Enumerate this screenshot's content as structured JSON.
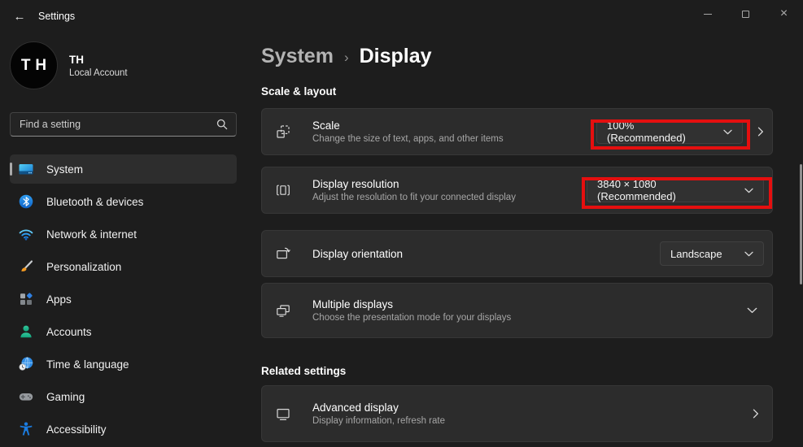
{
  "titlebar": {
    "title": "Settings",
    "back_glyph": "←",
    "close_glyph": "×"
  },
  "profile": {
    "initials": "TH",
    "name": "TH",
    "account_type": "Local Account"
  },
  "search": {
    "placeholder": "Find a setting",
    "icon": "search-icon"
  },
  "sidebar": {
    "items": [
      {
        "label": "System",
        "icon": "system-icon",
        "selected": true
      },
      {
        "label": "Bluetooth & devices",
        "icon": "bluetooth-icon",
        "selected": false
      },
      {
        "label": "Network & internet",
        "icon": "network-icon",
        "selected": false
      },
      {
        "label": "Personalization",
        "icon": "personalization-icon",
        "selected": false
      },
      {
        "label": "Apps",
        "icon": "apps-icon",
        "selected": false
      },
      {
        "label": "Accounts",
        "icon": "accounts-icon",
        "selected": false
      },
      {
        "label": "Time & language",
        "icon": "time-language-icon",
        "selected": false
      },
      {
        "label": "Gaming",
        "icon": "gaming-icon",
        "selected": false
      },
      {
        "label": "Accessibility",
        "icon": "accessibility-icon",
        "selected": false
      }
    ]
  },
  "page": {
    "breadcrumb_parent": "System",
    "breadcrumb_separator": "›",
    "title": "Display"
  },
  "scale_layout": {
    "heading": "Scale & layout",
    "scale": {
      "title": "Scale",
      "subtitle": "Change the size of text, apps, and other items",
      "value": "100% (Recommended)",
      "icon": "scale-icon",
      "annotated": true
    },
    "resolution": {
      "title": "Display resolution",
      "subtitle": "Adjust the resolution to fit your connected display",
      "value": "3840 × 1080 (Recommended)",
      "icon": "display-resolution-icon",
      "annotated": true
    },
    "orientation": {
      "title": "Display orientation",
      "value": "Landscape",
      "icon": "display-orientation-icon"
    },
    "multiple_displays": {
      "title": "Multiple displays",
      "subtitle": "Choose the presentation mode for your displays",
      "icon": "multiple-displays-icon"
    }
  },
  "related": {
    "heading": "Related settings",
    "advanced_display": {
      "title": "Advanced display",
      "subtitle": "Display information, refresh rate",
      "icon": "advanced-display-icon"
    }
  },
  "colors": {
    "annotation_red": "#e50f0f",
    "background": "#1d1d1d",
    "card": "#2c2c2c",
    "dropdown": "#313131"
  }
}
